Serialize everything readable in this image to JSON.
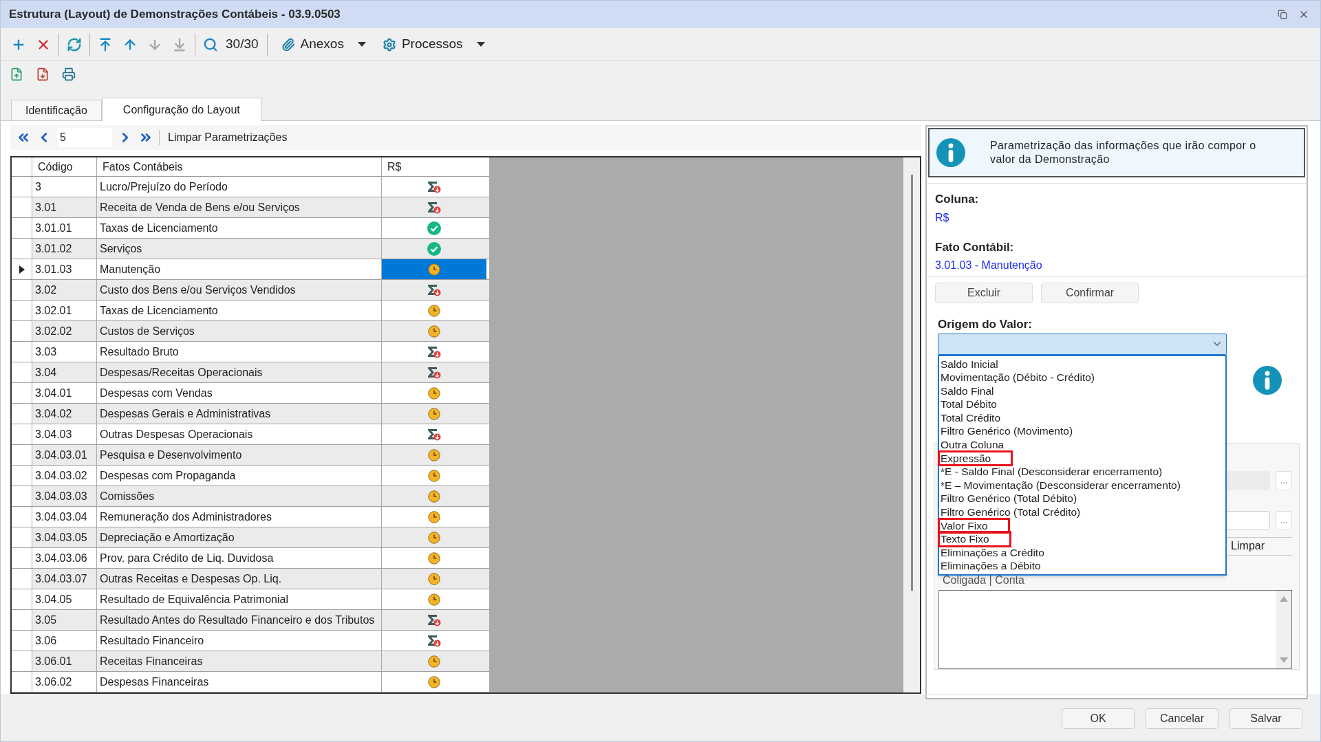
{
  "window": {
    "title": "Estrutura (Layout) de Demonstrações Contábeis - 03.9.0503"
  },
  "toolbar": {
    "buttons": [
      {
        "kind": "add",
        "disabled": false
      },
      {
        "kind": "delete",
        "disabled": false
      },
      {
        "kind": "refresh",
        "disabled": false
      },
      {
        "kind": "first",
        "disabled": false
      },
      {
        "kind": "up",
        "disabled": false
      },
      {
        "kind": "down",
        "disabled": true
      },
      {
        "kind": "last",
        "disabled": true
      },
      {
        "kind": "search",
        "disabled": false
      }
    ],
    "counter": "30/30",
    "menus": [
      {
        "kind": "attach",
        "label": "Anexos"
      },
      {
        "kind": "gear",
        "label": "Processos"
      }
    ]
  },
  "toolbar2": {
    "buttons": [
      {
        "kind": "import"
      },
      {
        "kind": "export"
      },
      {
        "kind": "print"
      }
    ]
  },
  "tabs": [
    {
      "label": "Identificação",
      "selected": false
    },
    {
      "label": "Configuração do Layout",
      "selected": true
    }
  ],
  "navigator": {
    "value": "5",
    "action": "Limpar Parametrizações"
  },
  "table": {
    "columns": [
      "Código",
      "Fatos Contábeis",
      "R$"
    ],
    "rows": [
      {
        "code": "3",
        "name": "Lucro/Prejuízo do Período",
        "kind": "sum",
        "selected": false
      },
      {
        "code": "3.01",
        "name": "Receita de Venda de Bens e/ou Serviços",
        "kind": "sum",
        "selected": false
      },
      {
        "code": "3.01.01",
        "name": "Taxas de Licenciamento",
        "kind": "ok",
        "selected": false
      },
      {
        "code": "3.01.02",
        "name": "Serviços",
        "kind": "ok",
        "selected": false
      },
      {
        "code": "3.01.03",
        "name": "Manutenção",
        "kind": "pending",
        "selected": true
      },
      {
        "code": "3.02",
        "name": "Custo dos Bens e/ou Serviços Vendidos",
        "kind": "sum",
        "selected": false
      },
      {
        "code": "3.02.01",
        "name": "Taxas de Licenciamento",
        "kind": "pending",
        "selected": false
      },
      {
        "code": "3.02.02",
        "name": "Custos de Serviços",
        "kind": "pending",
        "selected": false
      },
      {
        "code": "3.03",
        "name": "Resultado Bruto",
        "kind": "sum",
        "selected": false
      },
      {
        "code": "3.04",
        "name": "Despesas/Receitas Operacionais",
        "kind": "sum",
        "selected": false
      },
      {
        "code": "3.04.01",
        "name": "Despesas com Vendas",
        "kind": "pending",
        "selected": false
      },
      {
        "code": "3.04.02",
        "name": "Despesas Gerais e Administrativas",
        "kind": "pending",
        "selected": false
      },
      {
        "code": "3.04.03",
        "name": "Outras Despesas Operacionais",
        "kind": "sum",
        "selected": false
      },
      {
        "code": "3.04.03.01",
        "name": "Pesquisa e Desenvolvimento",
        "kind": "pending",
        "selected": false
      },
      {
        "code": "3.04.03.02",
        "name": "Despesas com Propaganda",
        "kind": "pending",
        "selected": false
      },
      {
        "code": "3.04.03.03",
        "name": "Comissões",
        "kind": "pending",
        "selected": false
      },
      {
        "code": "3.04.03.04",
        "name": "Remuneração dos Administradores",
        "kind": "pending",
        "selected": false
      },
      {
        "code": "3.04.03.05",
        "name": "Depreciação e Amortização",
        "kind": "pending",
        "selected": false
      },
      {
        "code": "3.04.03.06",
        "name": "Prov. para Crédito de Liq. Duvidosa",
        "kind": "pending",
        "selected": false
      },
      {
        "code": "3.04.03.07",
        "name": "Outras Receitas e Despesas Op. Liq.",
        "kind": "pending",
        "selected": false
      },
      {
        "code": "3.04.05",
        "name": "Resultado de Equivalência Patrimonial",
        "kind": "pending",
        "selected": false
      },
      {
        "code": "3.05",
        "name": "Resultado Antes do Resultado Financeiro e dos Tributos",
        "kind": "sum",
        "selected": false
      },
      {
        "code": "3.06",
        "name": "Resultado Financeiro",
        "kind": "sum",
        "selected": false
      },
      {
        "code": "3.06.01",
        "name": "Receitas Financeiras",
        "kind": "pending",
        "selected": false
      },
      {
        "code": "3.06.02",
        "name": "Despesas Financeiras",
        "kind": "pending",
        "selected": false
      }
    ]
  },
  "panel": {
    "info": "Parametrização das informações que irão compor o valor da Demonstração",
    "coluna_label": "Coluna:",
    "coluna_value": "R$",
    "fato_label": "Fato Contábil:",
    "fato_value": "3.01.03 - Manutenção",
    "buttons": [
      "Excluir",
      "Confirmar"
    ],
    "origem_label": "Origem do Valor:",
    "options": [
      {
        "label": "Saldo Inicial",
        "highlighted": false
      },
      {
        "label": "Movimentação (Débito - Crédito)",
        "highlighted": false
      },
      {
        "label": "Saldo Final",
        "highlighted": false
      },
      {
        "label": "Total Débito",
        "highlighted": false
      },
      {
        "label": "Total Crédito",
        "highlighted": false
      },
      {
        "label": "Filtro Genérico (Movimento)",
        "highlighted": false
      },
      {
        "label": "Outra Coluna",
        "highlighted": false
      },
      {
        "label": "Expressão",
        "highlighted": true
      },
      {
        "label": "*E - Saldo Final (Desconsiderar encerramento)",
        "highlighted": false
      },
      {
        "label": "*E – Movimentação (Desconsiderar encerramento)",
        "highlighted": false
      },
      {
        "label": "Filtro Genérico (Total Débito)",
        "highlighted": false
      },
      {
        "label": "Filtro Genérico (Total Crédito)",
        "highlighted": false
      },
      {
        "label": "Valor Fixo",
        "highlighted": true
      },
      {
        "label": "Texto Fixo",
        "highlighted": true
      },
      {
        "label": "Eliminações a Crédito",
        "highlighted": false
      },
      {
        "label": "Eliminações a Débito",
        "highlighted": false
      }
    ],
    "lookup_buttons": [
      "...",
      "..."
    ],
    "clear_tab": "Limpar",
    "list_label": "Coligada | Conta"
  },
  "footer": {
    "buttons": [
      "OK",
      "Cancelar",
      "Salvar"
    ]
  }
}
